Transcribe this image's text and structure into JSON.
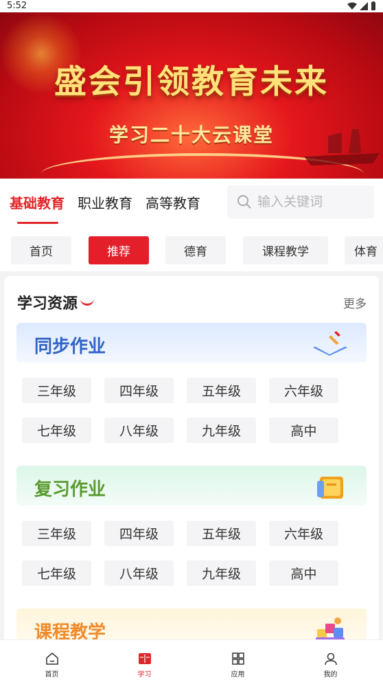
{
  "status_bar": {
    "time": "5:52"
  },
  "banner": {
    "title": "盛会引领教育未来",
    "subtitle": "学习二十大云课堂"
  },
  "main_tabs": [
    {
      "label": "基础教育",
      "active": true
    },
    {
      "label": "职业教育",
      "active": false
    },
    {
      "label": "高等教育",
      "active": false
    }
  ],
  "search": {
    "placeholder": "输入关键词",
    "icon": "search-icon"
  },
  "chips": [
    {
      "label": "首页",
      "active": false
    },
    {
      "label": "推荐",
      "active": true
    },
    {
      "label": "德育",
      "active": false
    },
    {
      "label": "课程教学",
      "active": false
    },
    {
      "label": "体育",
      "active": false
    }
  ],
  "resources": {
    "title": "学习资源",
    "more_label": "更多",
    "blocks": [
      {
        "title": "同步作业",
        "color": "#2f63c6",
        "icon": "notebook-pen-icon",
        "grades": [
          "三年级",
          "四年级",
          "五年级",
          "六年级",
          "七年级",
          "八年级",
          "九年级",
          "高中"
        ]
      },
      {
        "title": "复习作业",
        "color": "#5a9a2e",
        "icon": "review-book-icon",
        "grades": [
          "三年级",
          "四年级",
          "五年级",
          "六年级",
          "七年级",
          "八年级",
          "九年级",
          "高中"
        ]
      },
      {
        "title": "课程教学",
        "color": "#f08a2a",
        "icon": "course-blocks-icon",
        "grades": []
      }
    ]
  },
  "tab_bar": [
    {
      "label": "首页",
      "icon": "home-icon",
      "active": false
    },
    {
      "label": "学习",
      "icon": "study-icon",
      "active": true
    },
    {
      "label": "应用",
      "icon": "apps-grid-icon",
      "active": false
    },
    {
      "label": "我的",
      "icon": "profile-icon",
      "active": false
    }
  ],
  "colors": {
    "accent": "#e0262a",
    "blue": "#2f63c6",
    "green": "#5a9a2e",
    "orange": "#f08a2a"
  }
}
